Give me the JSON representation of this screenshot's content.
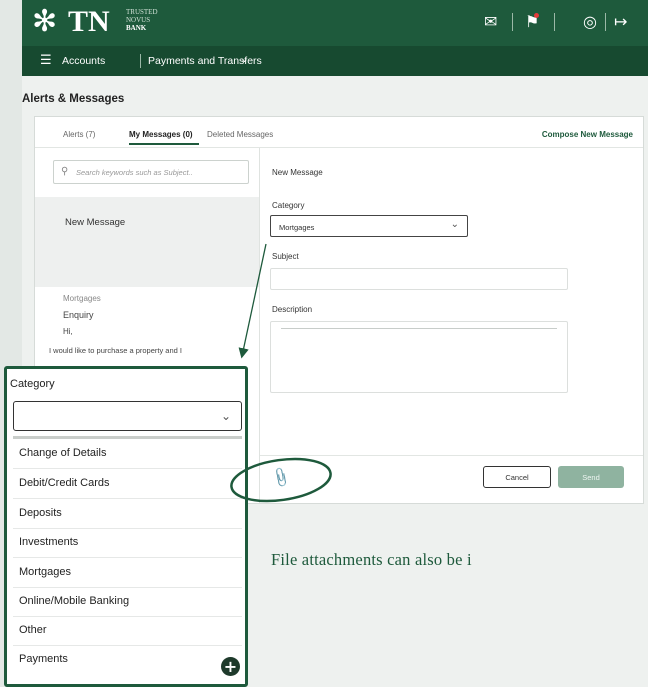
{
  "brand": {
    "mark": "✻",
    "name": "TN",
    "sub_lines": [
      "TRUSTED",
      "NOVUS",
      "BANK"
    ]
  },
  "topbar_icons": [
    {
      "name": "mail-icon",
      "glyph": "✉"
    },
    {
      "name": "notification-flag-icon",
      "glyph": "⚑"
    },
    {
      "name": "profile-icon",
      "glyph": "◎"
    },
    {
      "name": "logout-icon",
      "glyph": "↦"
    }
  ],
  "nav": {
    "menu_icon": "☰",
    "accounts": "Accounts",
    "payments": "Payments and Transfers",
    "chevron": "⌄"
  },
  "page": {
    "title": "Alerts & Messages"
  },
  "tabs": [
    {
      "label": "Alerts (7)"
    },
    {
      "label": "My Messages (0)"
    },
    {
      "label": "Deleted Messages"
    }
  ],
  "compose_label": "Compose New Message",
  "search": {
    "placeholder": "Search keywords such as Subject..",
    "icon": "⚲"
  },
  "message_list": {
    "selected": "New Message",
    "item": {
      "category": "Mortgages",
      "subject": "Enquiry",
      "greeting": "Hi,",
      "preview": "I would like to purchase a property and I"
    }
  },
  "form": {
    "heading": "New Message",
    "category_label": "Category",
    "category_value": "Mortgages",
    "subject_label": "Subject",
    "description_label": "Description",
    "cancel_label": "Cancel",
    "send_label": "Send",
    "attach_icon": "📎"
  },
  "dropdown": {
    "label": "Category",
    "options": [
      "Change of Details",
      "Debit/Credit Cards",
      "Deposits",
      "Investments",
      "Mortgages",
      "Online/Mobile Banking",
      "Other",
      "Payments"
    ],
    "plus_icon": "+"
  },
  "caption": "File attachments can also be i",
  "colors": {
    "brand_green": "#1e5a3c",
    "send_disabled": "#8fb3a0",
    "notification_dot": "#e23b3b"
  }
}
